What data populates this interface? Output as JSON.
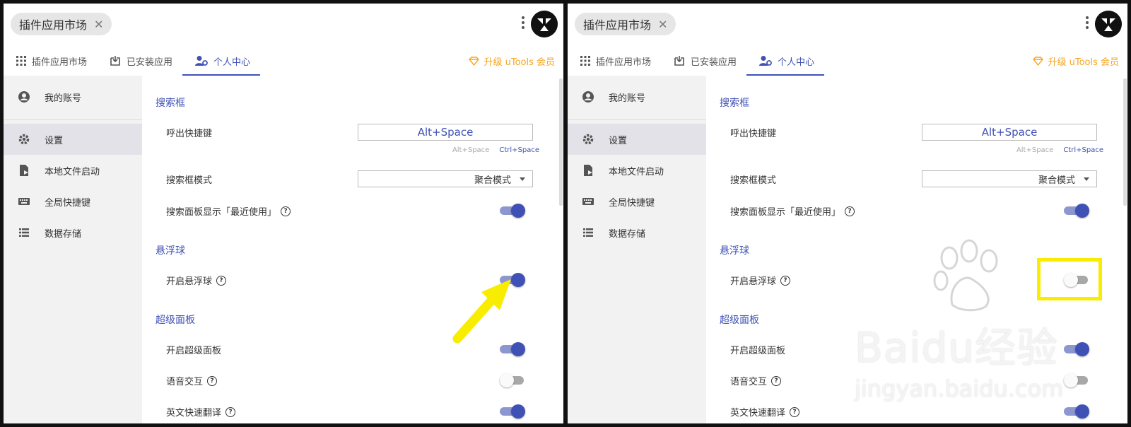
{
  "window": {
    "chip_label": "插件应用市场",
    "chip_close": "✕"
  },
  "tabs": [
    {
      "label": "插件应用市场",
      "icon": "grid-icon",
      "active": false
    },
    {
      "label": "已安装应用",
      "icon": "download-box-icon",
      "active": false
    },
    {
      "label": "个人中心",
      "icon": "user-settings-icon",
      "active": true
    }
  ],
  "upgrade_label": "升级 uTools 会员",
  "sidebar": {
    "items": [
      {
        "label": "我的账号",
        "icon": "account-circle-icon"
      },
      {
        "label": "设置",
        "icon": "gear-icon",
        "active": true
      },
      {
        "label": "本地文件启动",
        "icon": "file-launch-icon"
      },
      {
        "label": "全局快捷键",
        "icon": "keyboard-icon"
      },
      {
        "label": "数据存储",
        "icon": "list-icon"
      }
    ]
  },
  "settings": {
    "search_section": "搜索框",
    "hotkey_label": "呼出快捷键",
    "hotkey_value": "Alt+Space",
    "hotkey_option_a": "Alt+Space",
    "hotkey_option_b": "Ctrl+Space",
    "mode_label": "搜索框模式",
    "mode_value": "聚合模式",
    "recent_label": "搜索面板显示「最近使用」",
    "float_section": "悬浮球",
    "float_label": "开启悬浮球",
    "super_section": "超级面板",
    "super_label": "开启超级面板",
    "voice_label": "语音交互",
    "translate_label": "英文快速翻译",
    "help_glyph": "?"
  },
  "toggles": {
    "left": {
      "recent": true,
      "float": true,
      "super": true,
      "voice": false,
      "translate": true
    },
    "right": {
      "recent": true,
      "float": false,
      "super": true,
      "voice": false,
      "translate": true
    }
  },
  "watermark": {
    "main": "Baidu经验",
    "sub": "jingyan.baidu.com"
  },
  "colors": {
    "accent": "#3f51b5",
    "upgrade": "#f5a623",
    "highlight": "#f8ec00"
  }
}
